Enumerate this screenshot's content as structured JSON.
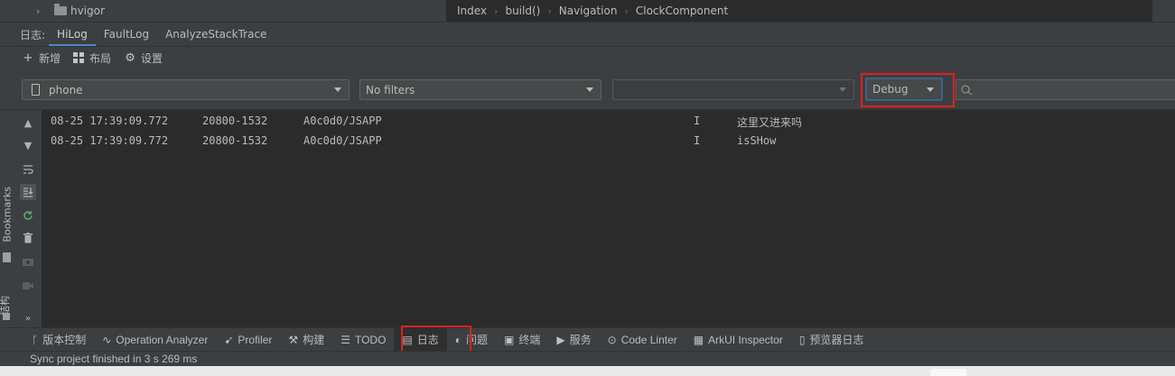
{
  "tree": {
    "folder_name": "hvigor"
  },
  "breadcrumb": [
    "Index",
    "build()",
    "Navigation",
    "ClockComponent"
  ],
  "tool_window": {
    "label": "日志:",
    "tabs": [
      "HiLog",
      "FaultLog",
      "AnalyzeStackTrace"
    ],
    "active_tab": "HiLog"
  },
  "toolbar": {
    "new_label": "新增",
    "layout_label": "布局",
    "settings_label": "设置"
  },
  "filters": {
    "device": "phone",
    "filter": "No filters",
    "process": "",
    "level": "Debug",
    "search_placeholder": ""
  },
  "side_panel": {
    "bookmarks": "Bookmarks",
    "structure": "结构"
  },
  "log": {
    "rows": [
      {
        "time": "08-25 17:39:09.772",
        "pid": "20800-1532",
        "tag": "A0c0d0/JSAPP",
        "level": "I",
        "message": "这里又进来吗"
      },
      {
        "time": "08-25 17:39:09.772",
        "pid": "20800-1532",
        "tag": "A0c0d0/JSAPP",
        "level": "I",
        "message": "isSHow"
      }
    ]
  },
  "bottom_tools": {
    "items": [
      "版本控制",
      "Operation Analyzer",
      "Profiler",
      "构建",
      "TODO",
      "日志",
      "问题",
      "终端",
      "服务",
      "Code Linter",
      "ArkUI Inspector",
      "预览器日志"
    ],
    "active": "日志"
  },
  "status": {
    "message": "Sync project finished in 3 s 269 ms"
  },
  "colors": {
    "background": "#2b2b2b",
    "panel": "#3c3f41",
    "accent": "#4a88c7",
    "highlight": "#e0201e"
  }
}
